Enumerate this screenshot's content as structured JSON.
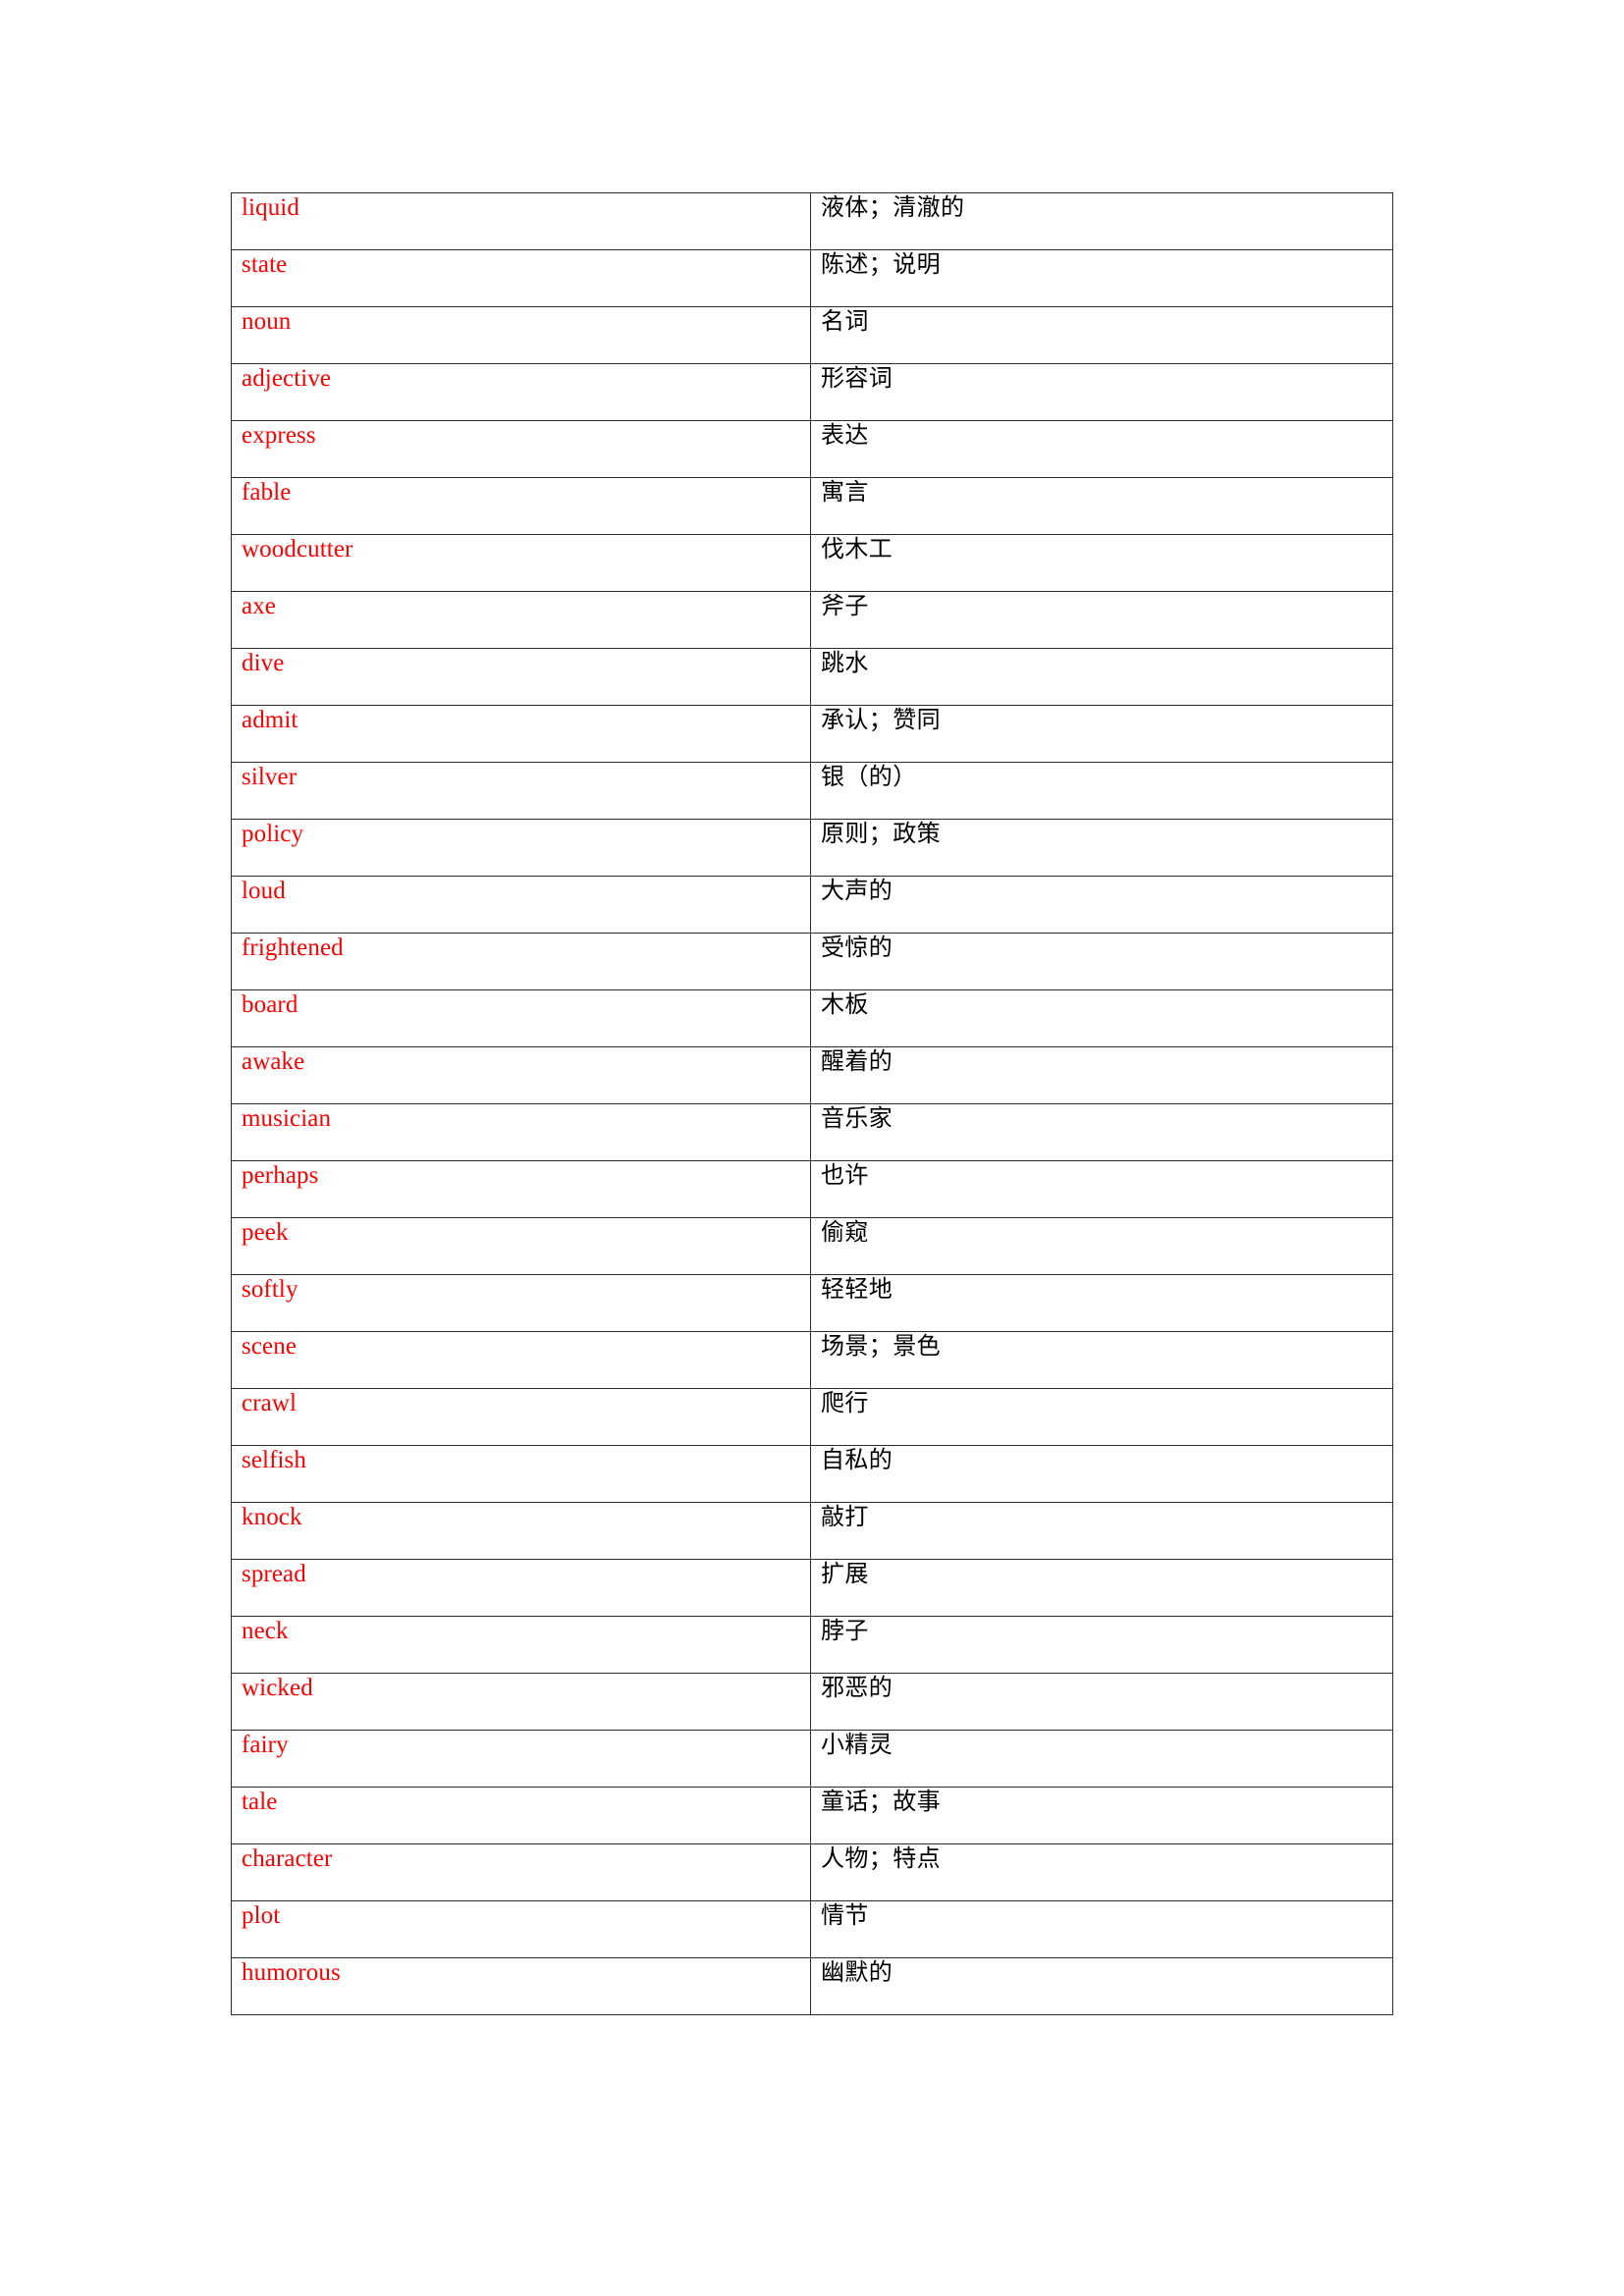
{
  "document": {
    "type": "vocabulary-table",
    "english_text_color": "#fe0000",
    "chinese_text_color": "#000000",
    "border_color": "#2b2b2b",
    "background_color": "#ffffff"
  },
  "table": {
    "columns": 2,
    "row_count": 31,
    "rows": [
      {
        "english": "liquid",
        "chinese": "液体；清澈的"
      },
      {
        "english": "state",
        "chinese": "陈述；说明"
      },
      {
        "english": "noun",
        "chinese": "名词"
      },
      {
        "english": "adjective",
        "chinese": "形容词"
      },
      {
        "english": "express",
        "chinese": "表达"
      },
      {
        "english": "fable",
        "chinese": "寓言"
      },
      {
        "english": "woodcutter",
        "chinese": "伐木工"
      },
      {
        "english": "axe",
        "chinese": "斧子"
      },
      {
        "english": "dive",
        "chinese": "跳水"
      },
      {
        "english": "admit",
        "chinese": "承认；赞同"
      },
      {
        "english": "silver",
        "chinese": "银（的）"
      },
      {
        "english": "policy",
        "chinese": "原则；政策"
      },
      {
        "english": "loud",
        "chinese": "大声的"
      },
      {
        "english": "frightened",
        "chinese": "受惊的"
      },
      {
        "english": "board",
        "chinese": "木板"
      },
      {
        "english": "awake",
        "chinese": "醒着的"
      },
      {
        "english": "musician",
        "chinese": "音乐家"
      },
      {
        "english": "perhaps",
        "chinese": "也许"
      },
      {
        "english": "peek",
        "chinese": "偷窥"
      },
      {
        "english": "softly",
        "chinese": "轻轻地"
      },
      {
        "english": "scene",
        "chinese": "场景；景色"
      },
      {
        "english": "crawl",
        "chinese": "爬行"
      },
      {
        "english": "selfish",
        "chinese": "自私的"
      },
      {
        "english": "knock",
        "chinese": "敲打"
      },
      {
        "english": "spread",
        "chinese": "扩展"
      },
      {
        "english": "neck",
        "chinese": "脖子"
      },
      {
        "english": "wicked",
        "chinese": "邪恶的"
      },
      {
        "english": "fairy",
        "chinese": "小精灵"
      },
      {
        "english": "tale",
        "chinese": "童话；故事"
      },
      {
        "english": "character",
        "chinese": "人物；特点"
      },
      {
        "english": "plot",
        "chinese": "情节"
      },
      {
        "english": "humorous",
        "chinese": "幽默的"
      }
    ]
  }
}
